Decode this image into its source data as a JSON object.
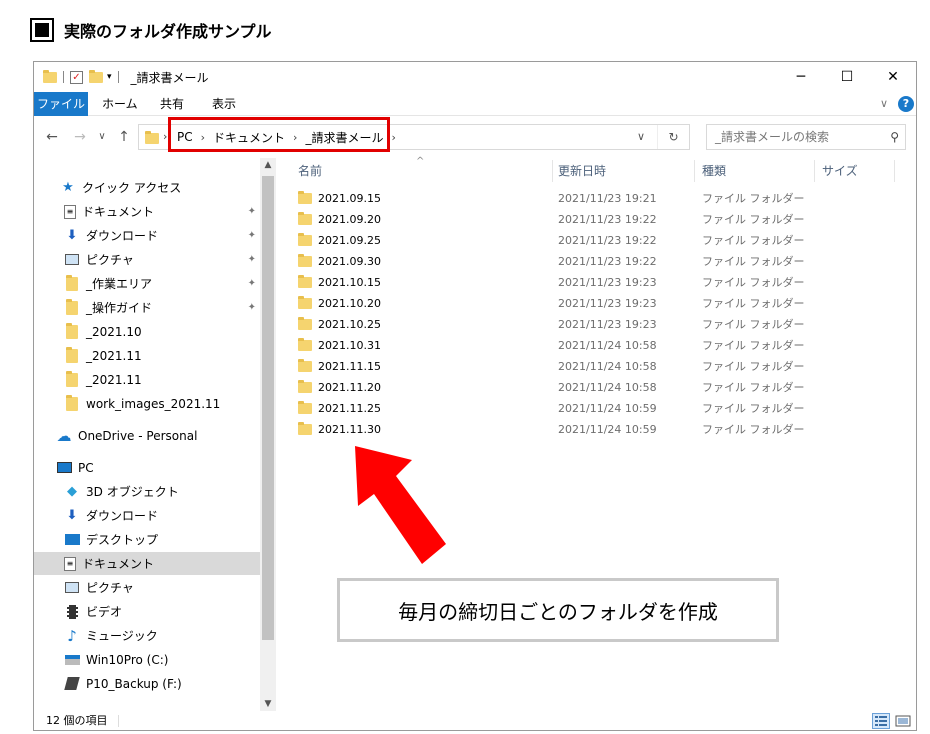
{
  "heading": "実際のフォルダ作成サンプル",
  "window": {
    "title": "_請求書メール",
    "controls": {
      "minimize": "─",
      "maximize": "☐",
      "close": "✕"
    }
  },
  "ribbon": {
    "tabs": [
      "ファイル",
      "ホーム",
      "共有",
      "表示"
    ],
    "expand": "∨",
    "help": "?"
  },
  "nav": {
    "back": "←",
    "forward": "→",
    "recent": "∨",
    "up": "↑",
    "breadcrumbs": [
      "PC",
      "ドキュメント",
      "_請求書メール"
    ],
    "sep": "›",
    "root_chevron": "›",
    "dropdown": "∨",
    "refresh": "↻",
    "search_placeholder": "_請求書メールの検索",
    "search_icon": "⚲"
  },
  "sidebar": {
    "quick_access": "クイック アクセス",
    "quick_items": [
      "ドキュメント",
      "ダウンロード",
      "ピクチャ",
      "_作業エリア",
      "_操作ガイド",
      "_2021.10",
      "_2021.11",
      "_2021.11",
      "work_images_2021.11"
    ],
    "onedrive": "OneDrive - Personal",
    "pc": "PC",
    "pc_items": [
      "3D オブジェクト",
      "ダウンロード",
      "デスクトップ",
      "ドキュメント",
      "ピクチャ",
      "ビデオ",
      "ミュージック",
      "Win10Pro (C:)",
      "P10_Backup (F:)"
    ],
    "scroll_up": "▲",
    "scroll_down": "▼"
  },
  "columns": {
    "name": "名前",
    "modified": "更新日時",
    "type": "種類",
    "size": "サイズ",
    "sort_caret": "^"
  },
  "files": [
    {
      "name": "2021.09.15",
      "modified": "2021/11/23 19:21",
      "type": "ファイル フォルダー"
    },
    {
      "name": "2021.09.20",
      "modified": "2021/11/23 19:22",
      "type": "ファイル フォルダー"
    },
    {
      "name": "2021.09.25",
      "modified": "2021/11/23 19:22",
      "type": "ファイル フォルダー"
    },
    {
      "name": "2021.09.30",
      "modified": "2021/11/23 19:22",
      "type": "ファイル フォルダー"
    },
    {
      "name": "2021.10.15",
      "modified": "2021/11/23 19:23",
      "type": "ファイル フォルダー"
    },
    {
      "name": "2021.10.20",
      "modified": "2021/11/23 19:23",
      "type": "ファイル フォルダー"
    },
    {
      "name": "2021.10.25",
      "modified": "2021/11/23 19:23",
      "type": "ファイル フォルダー"
    },
    {
      "name": "2021.10.31",
      "modified": "2021/11/24 10:58",
      "type": "ファイル フォルダー"
    },
    {
      "name": "2021.11.15",
      "modified": "2021/11/24 10:58",
      "type": "ファイル フォルダー"
    },
    {
      "name": "2021.11.20",
      "modified": "2021/11/24 10:58",
      "type": "ファイル フォルダー"
    },
    {
      "name": "2021.11.25",
      "modified": "2021/11/24 10:59",
      "type": "ファイル フォルダー"
    },
    {
      "name": "2021.11.30",
      "modified": "2021/11/24 10:59",
      "type": "ファイル フォルダー"
    }
  ],
  "status": {
    "count": "12 個の項目"
  },
  "callout": "毎月の締切日ごとのフォルダを作成",
  "colors": {
    "accent": "#1979ca",
    "highlight_red": "#e10000",
    "arrow_red": "#ff0000",
    "folder": "#f5d46f"
  }
}
